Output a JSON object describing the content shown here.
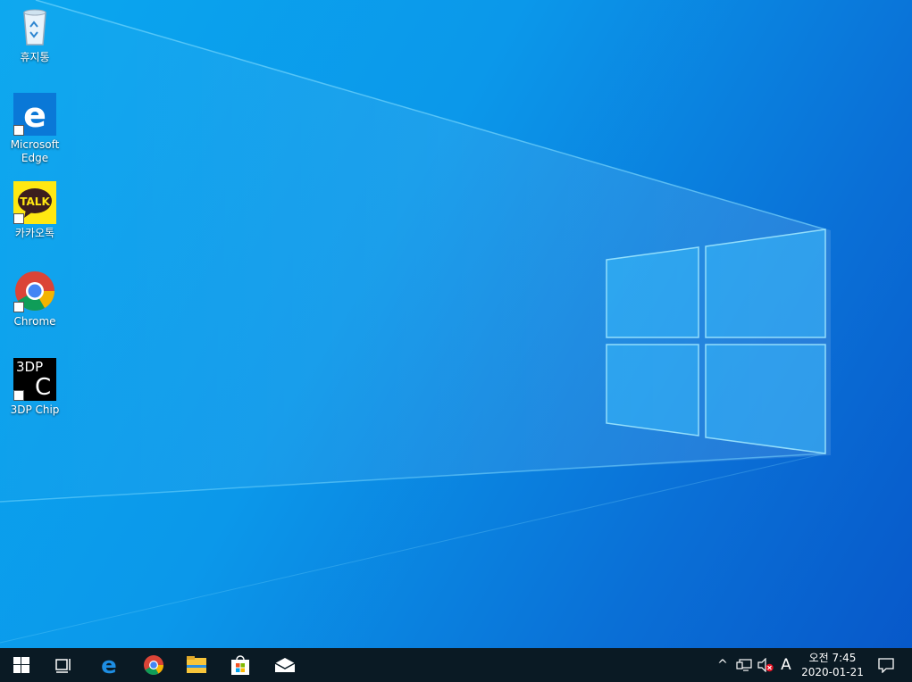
{
  "desktop": {
    "icons": [
      {
        "label": "휴지통",
        "icon": "recycle-bin-icon"
      },
      {
        "label": "Microsoft\nEdge",
        "icon": "edge-icon"
      },
      {
        "label": "카카오톡",
        "icon": "kakaotalk-icon",
        "badge": "TALK"
      },
      {
        "label": "Chrome",
        "icon": "chrome-icon"
      },
      {
        "label": "3DP Chip",
        "icon": "3dp-chip-icon",
        "badge": "3DP",
        "badge2": "C"
      }
    ]
  },
  "taskbar": {
    "pinned": [
      "start-icon",
      "task-view-icon",
      "edge-icon",
      "chrome-icon",
      "file-explorer-icon",
      "store-icon",
      "mail-icon"
    ],
    "tray": {
      "chevron": "^",
      "input_mode": "A",
      "time": "오전 7:45",
      "date": "2020-01-21"
    }
  },
  "colors": {
    "bg_light": "#0aa7ef",
    "bg_dark": "#0757c9",
    "taskbar": "#0a1a24"
  }
}
